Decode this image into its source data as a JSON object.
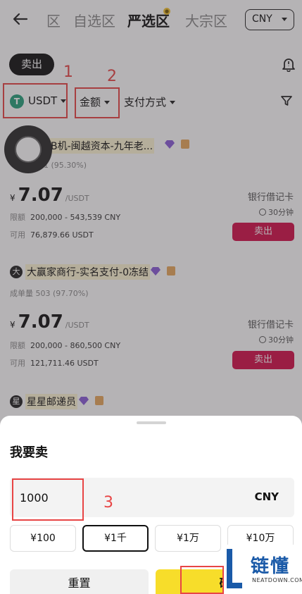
{
  "nav": {
    "tabs": [
      "区",
      "自选区",
      "严选区",
      "大宗区"
    ],
    "active_tab": "严选区",
    "currency": "CNY"
  },
  "action_pill": "卖出",
  "filters": {
    "coin": "USDT",
    "amount": "金额",
    "payment": "支付方式"
  },
  "listings": [
    {
      "merchant": "B机-闽越资本-九年老...",
      "stats": "1 (95.30%)",
      "price": "7.07",
      "price_unit": "/USDT",
      "limit_label": "限额",
      "limit_value": "200,000 - 543,539 CNY",
      "avail_label": "可用",
      "avail_value": "76,879.66 USDT",
      "pay_method": "银行借记卡",
      "time": "30分钟",
      "button": "卖出"
    },
    {
      "avatar": "大",
      "merchant": "大赢家商行-实名支付-0冻结",
      "stats_label": "成单量",
      "stats": "503 (97.70%)",
      "price": "7.07",
      "price_unit": "/USDT",
      "limit_label": "限额",
      "limit_value": "200,000 - 860,500 CNY",
      "avail_label": "可用",
      "avail_value": "121,711.46 USDT",
      "pay_method": "银行借记卡",
      "time": "30分钟",
      "button": "卖出"
    },
    {
      "avatar": "星",
      "merchant": "星星邮递员"
    }
  ],
  "yen": "¥",
  "sheet": {
    "title": "我要卖",
    "amount_value": "1000",
    "amount_currency": "CNY",
    "quick_amounts": [
      "¥100",
      "¥1千",
      "¥1万",
      "¥10万"
    ],
    "selected_quick": "¥1千",
    "reset_label": "重置",
    "confirm_label": "确"
  },
  "annotations": [
    "1",
    "2",
    "3"
  ],
  "watermark": {
    "text": "链懂",
    "sub": "NEATDOWN.COM"
  },
  "colors": {
    "sell_red": "#d4104a",
    "confirm_yellow": "#f7dd2a",
    "annotation_red": "#e84545",
    "usdt_green": "#26a17b"
  }
}
